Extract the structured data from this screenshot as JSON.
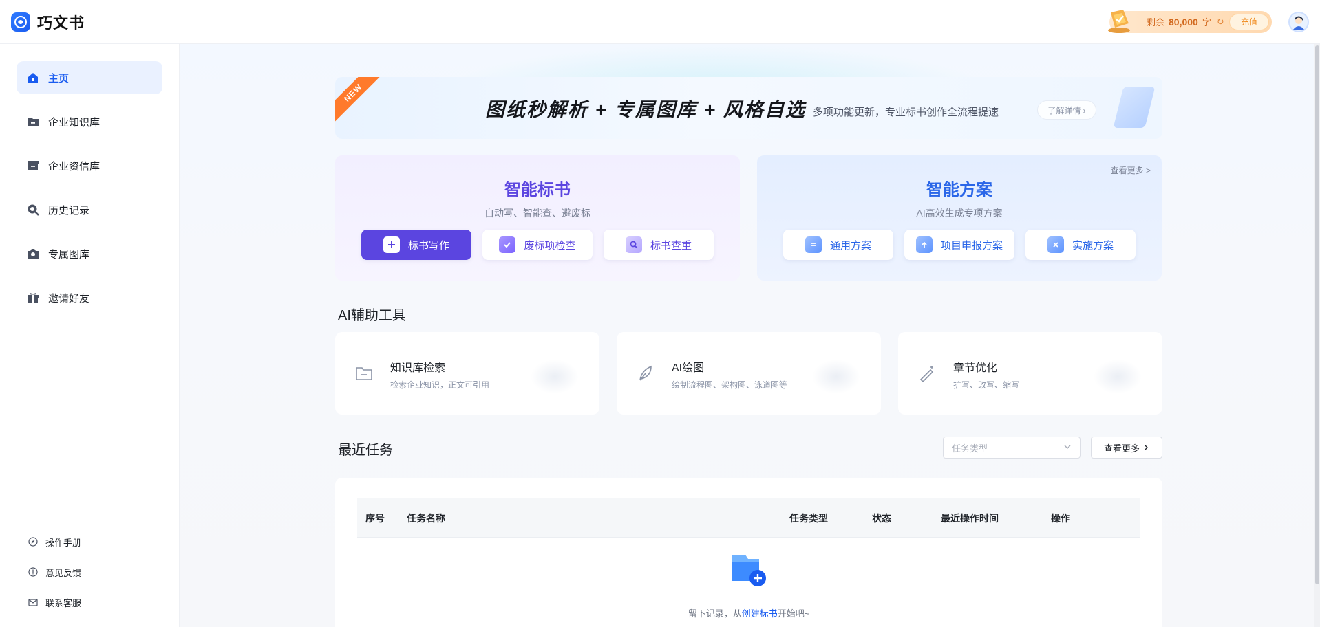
{
  "app": {
    "name": "巧文书"
  },
  "header": {
    "balance_label": "剩余",
    "balance_value": "80,000",
    "balance_unit": "字",
    "recharge_label": "充值"
  },
  "sidebar": {
    "items": [
      {
        "label": "主页",
        "icon": "home-icon",
        "active": true
      },
      {
        "label": "企业知识库",
        "icon": "folder-icon",
        "active": false
      },
      {
        "label": "企业资信库",
        "icon": "archive-icon",
        "active": false
      },
      {
        "label": "历史记录",
        "icon": "history-search-icon",
        "active": false
      },
      {
        "label": "专属图库",
        "icon": "camera-icon",
        "active": false
      },
      {
        "label": "邀请好友",
        "icon": "gift-icon",
        "active": false
      }
    ],
    "footer": [
      {
        "label": "操作手册",
        "icon": "compass-icon"
      },
      {
        "label": "意见反馈",
        "icon": "info-icon"
      },
      {
        "label": "联系客服",
        "icon": "mail-icon"
      }
    ]
  },
  "banner": {
    "badge": "NEW",
    "title": "图纸秒解析 + 专属图库 + 风格自选",
    "subtitle": "多项功能更新，专业标书创作全流程提速",
    "button": "了解详情 ›"
  },
  "smart_bid": {
    "title": "智能标书",
    "subtitle": "自动写、智能查、避废标",
    "buttons": [
      "标书写作",
      "废标项检查",
      "标书查重"
    ]
  },
  "smart_plan": {
    "title": "智能方案",
    "subtitle": "AI高效生成专项方案",
    "more": "查看更多 >",
    "buttons": [
      "通用方案",
      "项目申报方案",
      "实施方案"
    ]
  },
  "ai_tools": {
    "title": "AI辅助工具",
    "items": [
      {
        "name": "知识库检索",
        "desc": "检索企业知识，正文可引用",
        "icon": "folder-outline-icon"
      },
      {
        "name": "AI绘图",
        "desc": "绘制流程图、架构图、泳道图等",
        "icon": "feather-pen-icon"
      },
      {
        "name": "章节优化",
        "desc": "扩写、改写、缩写",
        "icon": "magic-wand-icon"
      }
    ]
  },
  "recent": {
    "title": "最近任务",
    "filter_placeholder": "任务类型",
    "more": "查看更多",
    "columns": [
      "序号",
      "任务名称",
      "任务类型",
      "状态",
      "最近操作时间",
      "操作"
    ],
    "empty_prefix": "留下记录，从",
    "empty_link": "创建标书",
    "empty_suffix": "开始吧~"
  },
  "colors": {
    "brand": "#1a5cf0",
    "purple": "#5b45e0",
    "orange": "#f08a1c"
  }
}
